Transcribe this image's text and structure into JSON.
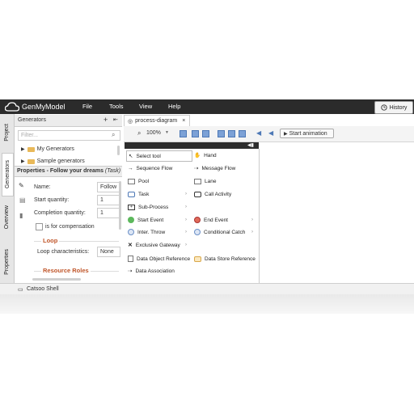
{
  "app": {
    "logo": "GenMyModel",
    "menu": [
      "File",
      "Tools",
      "View",
      "Help"
    ],
    "history_label": "History"
  },
  "sidebar_tabs": [
    "Project",
    "Generators",
    "Overview",
    "Properties"
  ],
  "generators": {
    "title": "Generators",
    "filter_placeholder": "Filter...",
    "items": [
      "My Generators",
      "Sample generators"
    ]
  },
  "properties": {
    "title": "Properties - Follow your dreams",
    "title_suffix": "(Task)",
    "name_label": "Name:",
    "name_value": "Follow",
    "start_qty_label": "Start quantity:",
    "start_qty_value": "1",
    "completion_qty_label": "Completion quantity:",
    "completion_qty_value": "1",
    "compensation_label": "is for compensation",
    "loop_title": "Loop",
    "loop_label": "Loop characteristics:",
    "loop_value": "None",
    "resource_title": "Resource Roles"
  },
  "editor": {
    "tab_label": "process-diagram",
    "zoom": "100%",
    "animation_label": "Start animation"
  },
  "palette": {
    "left": [
      "Select tool",
      "Sequence Flow",
      "Pool",
      "Task",
      "Sub-Process",
      "Start Event",
      "Inter. Throw",
      "Exclusive Gateway",
      "Data Object Reference",
      "Data Association"
    ],
    "right": [
      "Hand",
      "Message Flow",
      "Lane",
      "Call Activity",
      "End Event",
      "Conditional Catch",
      "Data Store Reference"
    ]
  },
  "bottom": {
    "shell_label": "Catsoo Shell"
  },
  "colors": {
    "topbar": "#2b2b2b",
    "accent": "#c0562a",
    "start_event": "#5cb85c",
    "end_event": "#e06b5a"
  }
}
